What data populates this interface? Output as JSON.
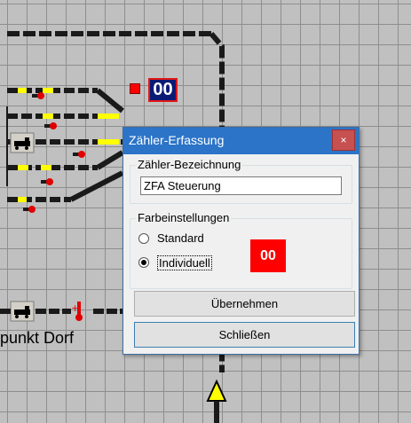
{
  "layout": {
    "counter_display": "00",
    "station_label": "punkt Dorf"
  },
  "dialog": {
    "title": "Zähler-Erfassung",
    "close_glyph": "×",
    "name_group_label": "Zähler-Bezeichnung",
    "name_value": "ZFA Steuerung",
    "color_group_label": "Farbeinstellungen",
    "radio_standard": "Standard",
    "radio_individual": "Individuell",
    "selected_option": "Individuell",
    "preview_text": "00",
    "apply_button": "Übernehmen",
    "close_button": "Schließen"
  },
  "colors": {
    "grid": "#c0c0c0",
    "titlebar": "#2b74c8",
    "counter_bg": "#0a1b75",
    "preview_bg": "#ff0000",
    "track": "#1a1a1a",
    "segment_yellow": "#ffff00",
    "segment_red": "#e00000"
  }
}
